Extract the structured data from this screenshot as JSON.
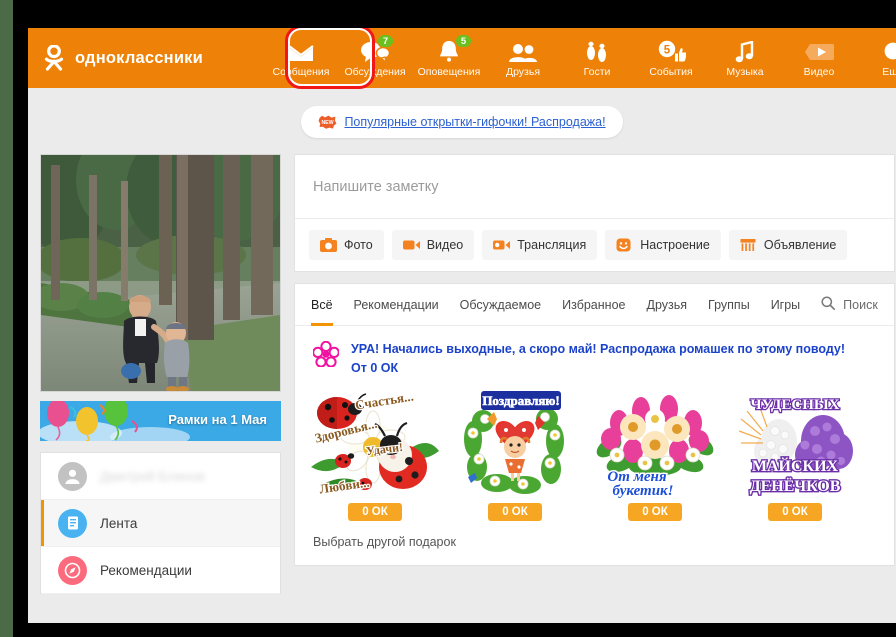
{
  "header": {
    "logo_text": "одноклассники",
    "logo_icon": "ok-logo-icon",
    "nav": [
      {
        "label": "Сообщения",
        "icon": "envelope-icon",
        "badge": null,
        "highlighted": true
      },
      {
        "label": "Обсуждения",
        "icon": "speech-bubbles-icon",
        "badge": "7"
      },
      {
        "label": "Оповещения",
        "icon": "bell-icon",
        "badge": "5"
      },
      {
        "label": "Друзья",
        "icon": "people-icon",
        "badge": null
      },
      {
        "label": "Гости",
        "icon": "footprints-icon",
        "badge": null
      },
      {
        "label": "События",
        "icon": "events-thumbsup-icon",
        "badge": null,
        "inline_count": "5"
      },
      {
        "label": "Музыка",
        "icon": "music-note-icon",
        "badge": null
      },
      {
        "label": "Видео",
        "icon": "video-play-icon",
        "badge": null
      },
      {
        "label": "Ещё",
        "icon": "more-circle-icon",
        "badge": null
      }
    ]
  },
  "promo_banner": {
    "icon": "new-sticker-icon",
    "link_text": "Популярные открытки-гифочки! Распродажа!"
  },
  "sidebar": {
    "photo_alt": "profile-photo-man-and-child-in-park",
    "banner": {
      "label": "Рамки на 1 Мая",
      "icon": "balloons-icon"
    },
    "items": [
      {
        "label": "Дмитрий Блинов",
        "icon": "user-avatar-icon",
        "active": false,
        "blurred": true
      },
      {
        "label": "Лента",
        "icon": "feed-icon",
        "active": true,
        "blurred": false
      },
      {
        "label": "Рекомендации",
        "icon": "compass-icon",
        "active": false,
        "blurred": false
      }
    ]
  },
  "composer": {
    "placeholder": "Напишите заметку",
    "actions": [
      {
        "label": "Фото",
        "icon": "camera-icon"
      },
      {
        "label": "Видео",
        "icon": "video-camera-icon"
      },
      {
        "label": "Трансляция",
        "icon": "broadcast-icon"
      },
      {
        "label": "Настроение",
        "icon": "smiley-icon"
      },
      {
        "label": "Объявление",
        "icon": "announcement-icon"
      }
    ]
  },
  "feed": {
    "tabs": [
      {
        "label": "Всё",
        "active": true
      },
      {
        "label": "Рекомендации",
        "active": false
      },
      {
        "label": "Обсуждаемое",
        "active": false
      },
      {
        "label": "Избранное",
        "active": false
      },
      {
        "label": "Друзья",
        "active": false
      },
      {
        "label": "Группы",
        "active": false
      },
      {
        "label": "Игры",
        "active": false
      }
    ],
    "search": {
      "label": "Поиск",
      "icon": "search-icon"
    },
    "gift_promo": {
      "icon": "flower-icon",
      "line1": "УРА! Начались выходные, а скоро май! Распродажа ромашек по этому поводу!",
      "line2": "От 0 ОК"
    },
    "gifts": [
      {
        "name": "ladybugs-card",
        "caption": "Счастья... Здоровья... Удачи... Любви...",
        "price": "0 ОК"
      },
      {
        "name": "congratulations-card",
        "caption": "Поздравляю!",
        "price": "0 ОК"
      },
      {
        "name": "bouquet-card",
        "caption": "От меня букетик!",
        "price": "0 ОК"
      },
      {
        "name": "may-days-card",
        "caption": "ЧУДЕСНЫХ МАЙСКИХ ДЕНЁЧКОВ",
        "price": "0 ОК"
      }
    ],
    "other_gift_link": "Выбрать другой подарок"
  },
  "colors": {
    "brand_orange": "#ee8208",
    "accent_orange": "#f29400",
    "badge_green": "#6bbf1f",
    "link_blue": "#2b61d1",
    "promo_blue": "#1b43c9",
    "highlight_red": "#f21616",
    "page_bg": "#ebebeb"
  }
}
